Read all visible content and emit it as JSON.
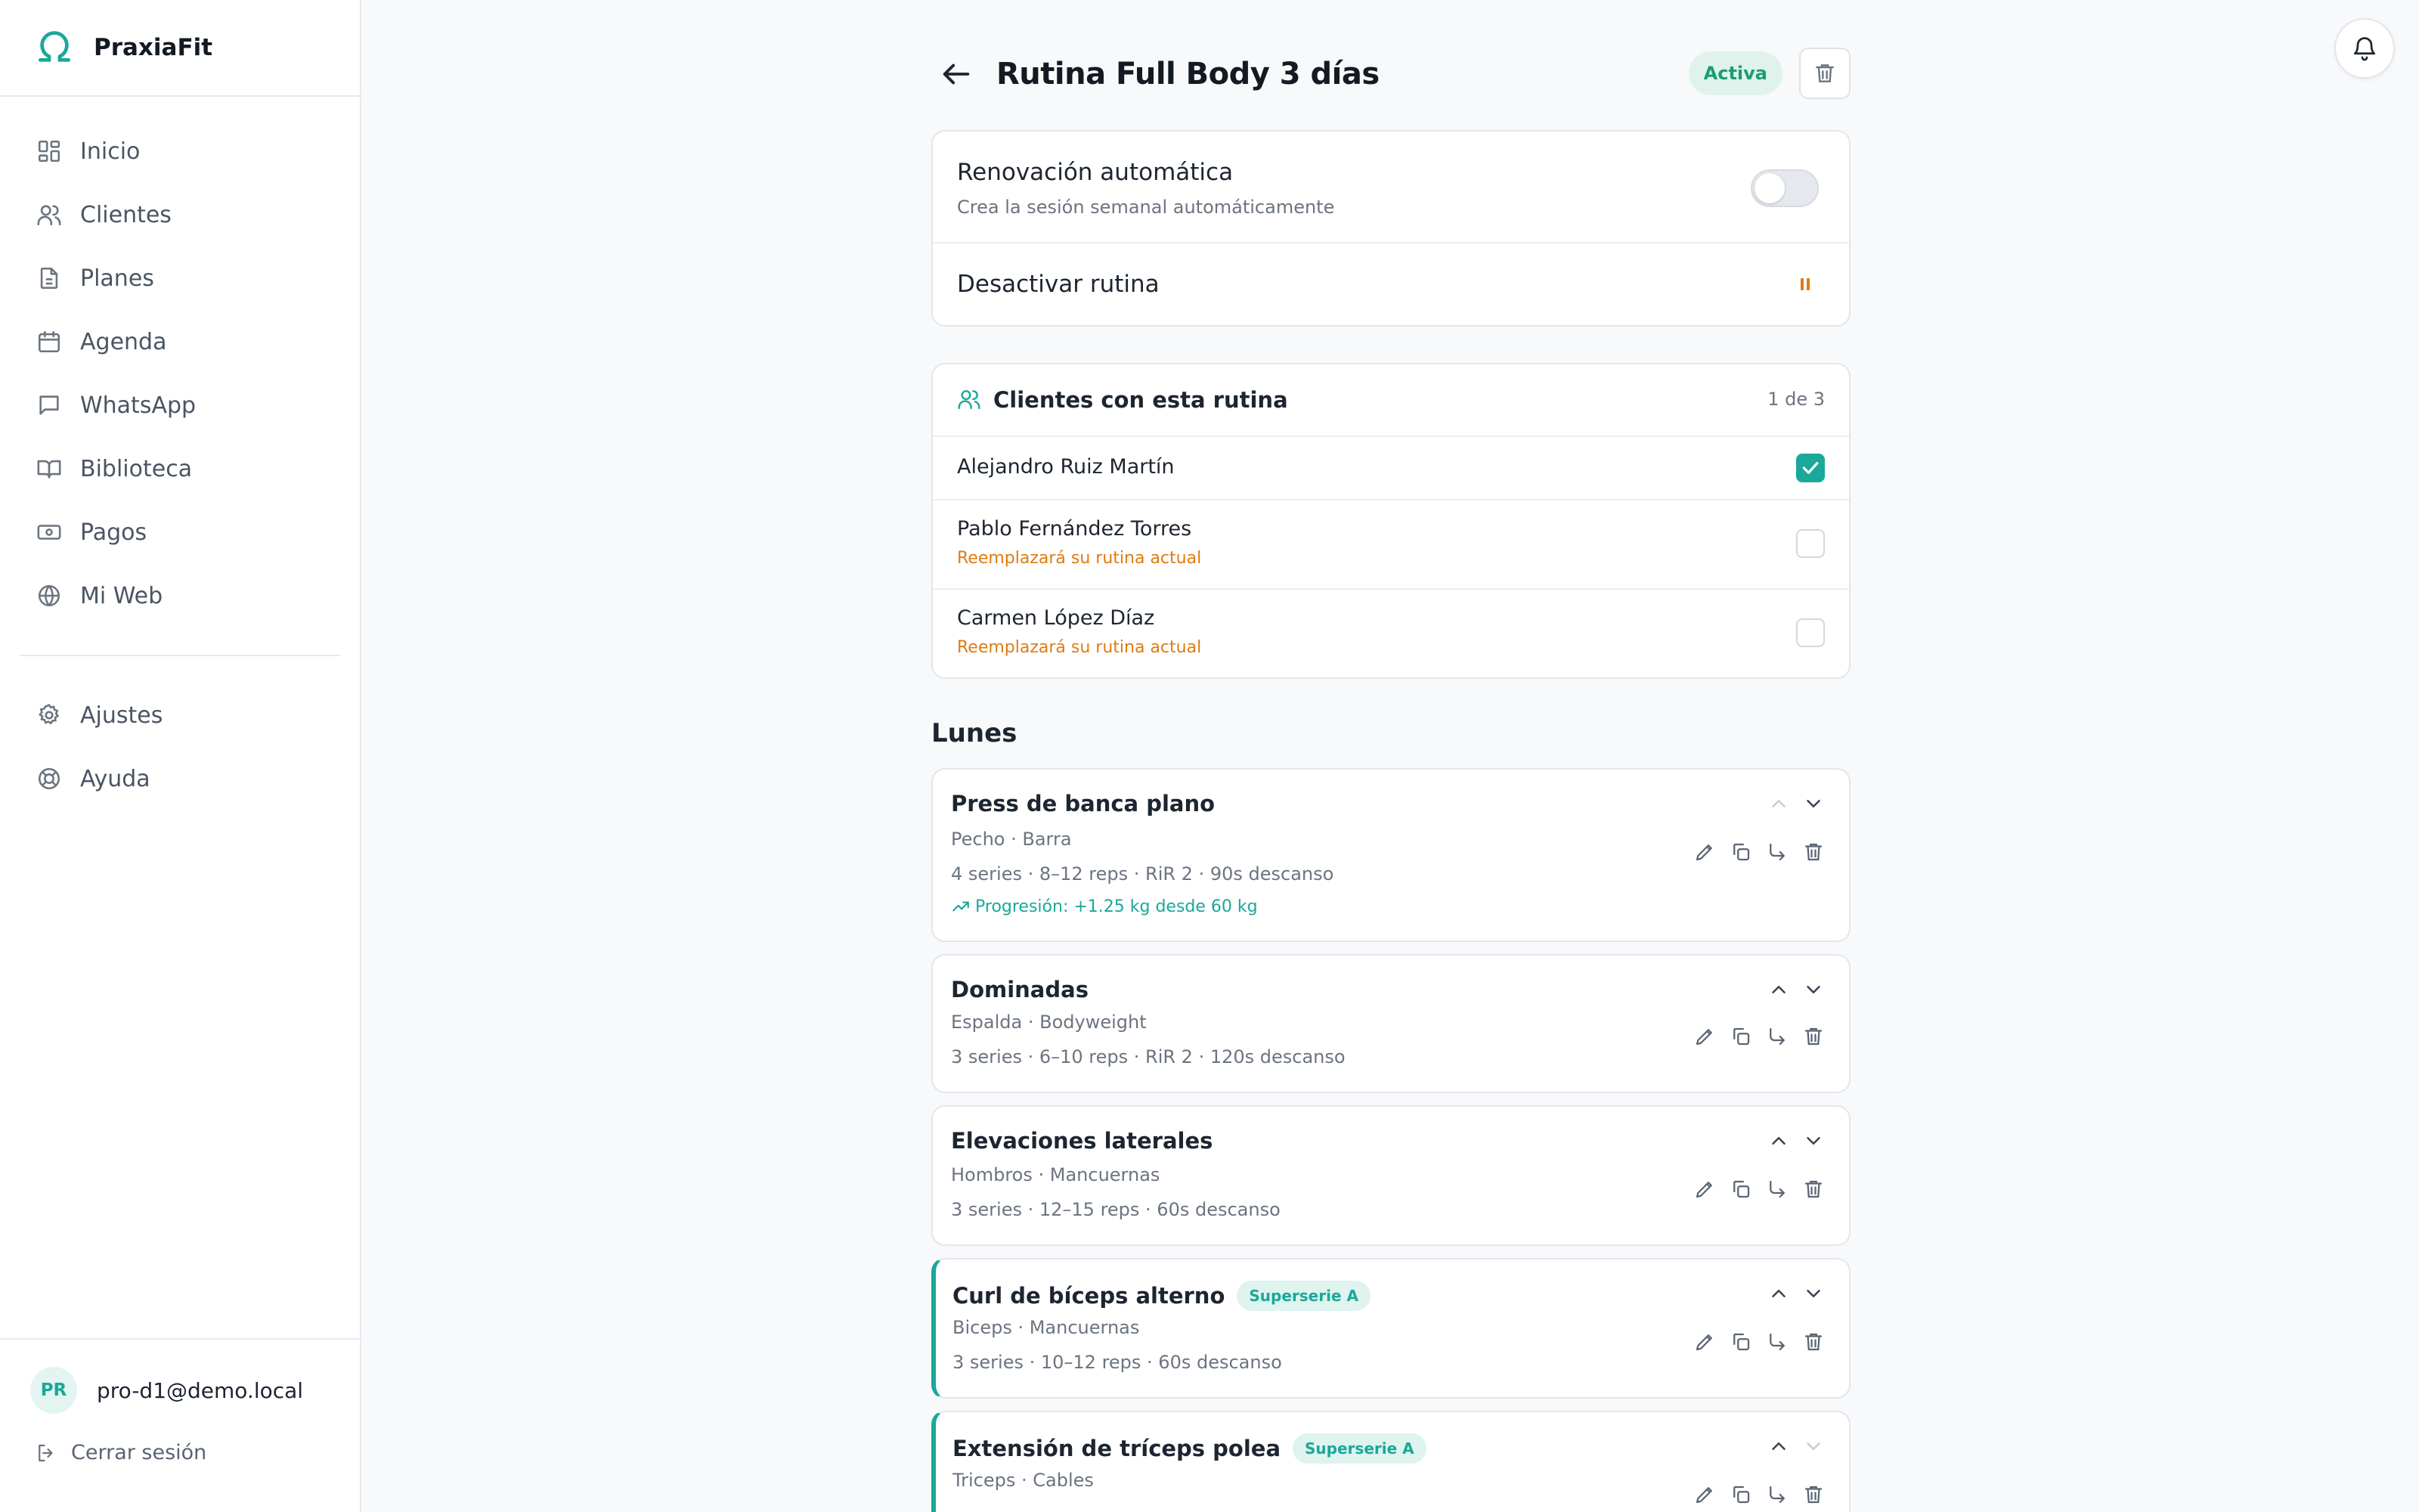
{
  "brand": {
    "name": "PraxiaFit",
    "color": "#1aa89a"
  },
  "sidebar": {
    "items": [
      {
        "label": "Inicio",
        "icon": "dashboard-icon"
      },
      {
        "label": "Clientes",
        "icon": "users-icon"
      },
      {
        "label": "Planes",
        "icon": "document-icon"
      },
      {
        "label": "Agenda",
        "icon": "calendar-icon"
      },
      {
        "label": "WhatsApp",
        "icon": "chat-icon"
      },
      {
        "label": "Biblioteca",
        "icon": "book-icon"
      },
      {
        "label": "Pagos",
        "icon": "money-icon"
      },
      {
        "label": "Mi Web",
        "icon": "globe-icon"
      }
    ],
    "secondary": [
      {
        "label": "Ajustes",
        "icon": "gear-icon"
      },
      {
        "label": "Ayuda",
        "icon": "lifebuoy-icon"
      }
    ],
    "user": {
      "initials": "PR",
      "email": "pro-d1@demo.local"
    },
    "logout_label": "Cerrar sesión"
  },
  "header": {
    "title": "Rutina Full Body 3 días",
    "status": "Activa"
  },
  "settings": {
    "auto_renew_title": "Renovación automática",
    "auto_renew_sub": "Crea la sesión semanal automáticamente",
    "auto_renew_on": false,
    "deactivate_label": "Desactivar rutina"
  },
  "clients": {
    "title": "Clientes con esta rutina",
    "count": "1 de 3",
    "rows": [
      {
        "name": "Alejandro Ruiz Martín",
        "checked": true,
        "warning": ""
      },
      {
        "name": "Pablo Fernández Torres",
        "checked": false,
        "warning": "Reemplazará su rutina actual"
      },
      {
        "name": "Carmen López Díaz",
        "checked": false,
        "warning": "Reemplazará su rutina actual"
      }
    ]
  },
  "day": {
    "title": "Lunes"
  },
  "exercises": [
    {
      "name": "Press de banca plano",
      "meta": "Pecho · Barra",
      "params": "4 series · 8–12 reps · RiR 2 · 90s descanso",
      "progression": "Progresión: +1.25 kg desde 60 kg",
      "badge": ""
    },
    {
      "name": "Dominadas",
      "meta": "Espalda · Bodyweight",
      "params": "3 series · 6–10 reps · RiR 2 · 120s descanso",
      "progression": "",
      "badge": ""
    },
    {
      "name": "Elevaciones laterales",
      "meta": "Hombros · Mancuernas",
      "params": "3 series · 12–15 reps · 60s descanso",
      "progression": "",
      "badge": ""
    },
    {
      "name": "Curl de bíceps alterno",
      "meta": "Biceps · Mancuernas",
      "params": "3 series · 10–12 reps · 60s descanso",
      "progression": "",
      "badge": "Superserie A"
    },
    {
      "name": "Extensión de tríceps polea",
      "meta": "Triceps · Cables",
      "params": "",
      "progression": "",
      "badge": "Superserie A"
    }
  ],
  "colors": {
    "accent": "#1aa89a",
    "warning": "#e07b12",
    "active_badge": "#1d9c6f"
  }
}
